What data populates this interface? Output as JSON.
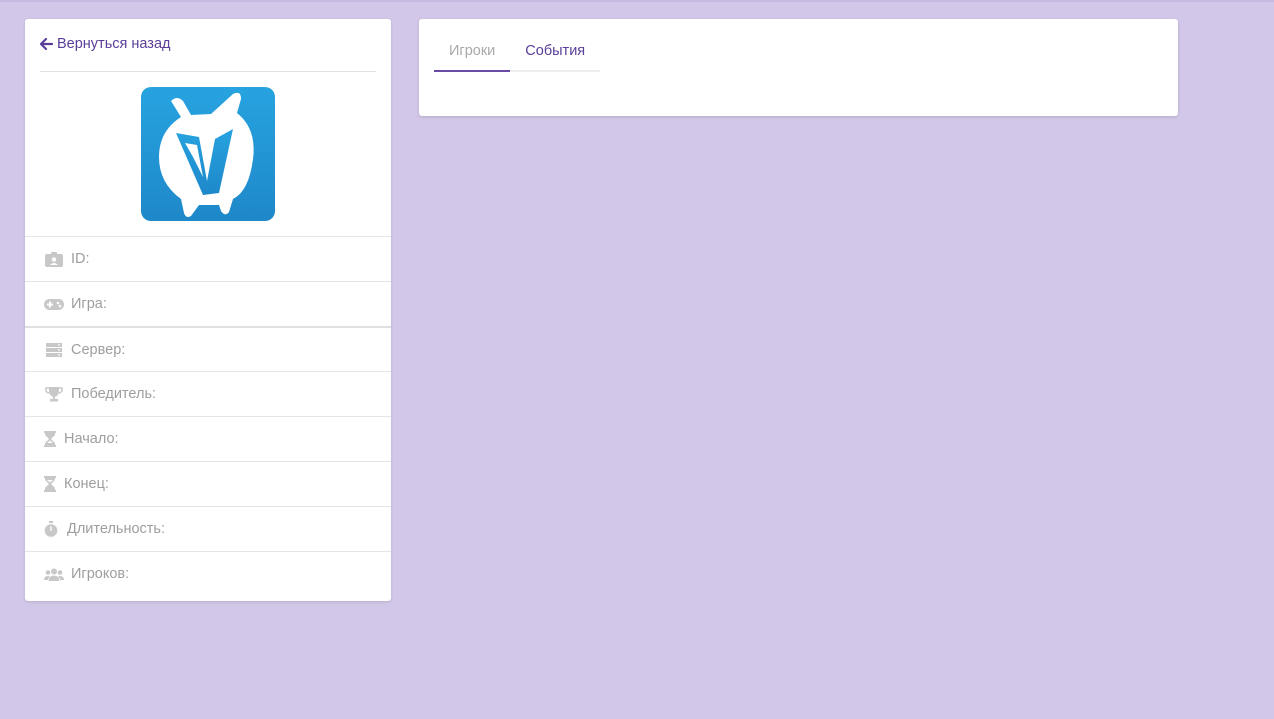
{
  "back": {
    "label": "Вернуться назад"
  },
  "info": {
    "id_label": "ID:",
    "game_label": "Игра:",
    "server_label": "Сервер:",
    "winner_label": "Победитель:",
    "start_label": "Начало:",
    "end_label": "Конец:",
    "duration_label": "Длительность:",
    "players_label": "Игроков:"
  },
  "tabs": [
    {
      "label": "Игроки",
      "active": true
    },
    {
      "label": "События",
      "active": false
    }
  ],
  "colors": {
    "background": "#d2c7e8",
    "accent": "#5b3e9a",
    "logo_blue": "#2196d8",
    "muted_icon": "#c8c8c8"
  },
  "icons": [
    "arrow-left-icon",
    "id-card-icon",
    "gamepad-icon",
    "server-icon",
    "trophy-icon",
    "hourglass-icon",
    "stopwatch-icon",
    "users-icon"
  ]
}
